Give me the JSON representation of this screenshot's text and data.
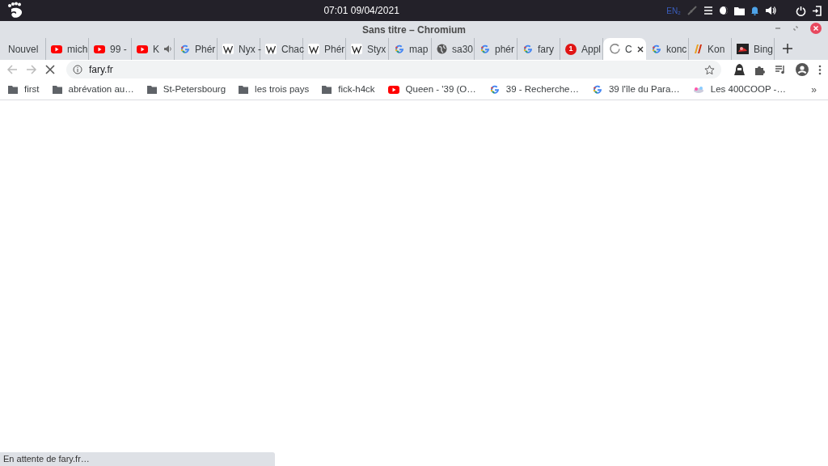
{
  "top_bar": {
    "clock": "07:01 09/04/2021",
    "keyboard_layout": "EN₂"
  },
  "window": {
    "title": "Sans titre – Chromium"
  },
  "tabs": [
    {
      "kind": "blank",
      "title": "Nouvel",
      "selected": false
    },
    {
      "kind": "youtube",
      "title": "mich",
      "selected": false
    },
    {
      "kind": "youtube",
      "title": "99 - ",
      "selected": false
    },
    {
      "kind": "youtube",
      "title": "K",
      "selected": false,
      "audio": true
    },
    {
      "kind": "google",
      "title": "Phér",
      "selected": false
    },
    {
      "kind": "wikipedia",
      "title": "Nyx -",
      "selected": false
    },
    {
      "kind": "wikipedia",
      "title": "Chac",
      "selected": false
    },
    {
      "kind": "wikipedia",
      "title": "Phér",
      "selected": false
    },
    {
      "kind": "wikipedia",
      "title": "Styx",
      "selected": false
    },
    {
      "kind": "google",
      "title": "map",
      "selected": false
    },
    {
      "kind": "globe",
      "title": "sa30",
      "selected": false
    },
    {
      "kind": "google",
      "title": "phér",
      "selected": false
    },
    {
      "kind": "google",
      "title": "fary",
      "selected": false
    },
    {
      "kind": "badge",
      "badge": "1",
      "title": "Appl",
      "selected": false
    },
    {
      "kind": "spinner",
      "title": "C",
      "selected": true
    },
    {
      "kind": "google",
      "title": "konc",
      "selected": false
    },
    {
      "kind": "stripes",
      "title": "Kon",
      "selected": false
    },
    {
      "kind": "bing",
      "title": "Bing",
      "selected": false
    }
  ],
  "address_bar": {
    "url": "fary.fr",
    "loading": true
  },
  "bookmarks": [
    {
      "kind": "folder",
      "label": "first"
    },
    {
      "kind": "folder",
      "label": "abrévation au…"
    },
    {
      "kind": "folder",
      "label": "St-Petersbourg"
    },
    {
      "kind": "folder",
      "label": "les trois pays"
    },
    {
      "kind": "folder",
      "label": "fick-h4ck"
    },
    {
      "kind": "youtube",
      "label": "Queen - '39 (O…"
    },
    {
      "kind": "google",
      "label": "39 - Recherche…"
    },
    {
      "kind": "google",
      "label": "39 l'île du Para…"
    },
    {
      "kind": "cloud",
      "label": "Les 400COOP -…"
    }
  ],
  "more_bookmarks": "»",
  "status_bar": "En attente de fary.fr…"
}
